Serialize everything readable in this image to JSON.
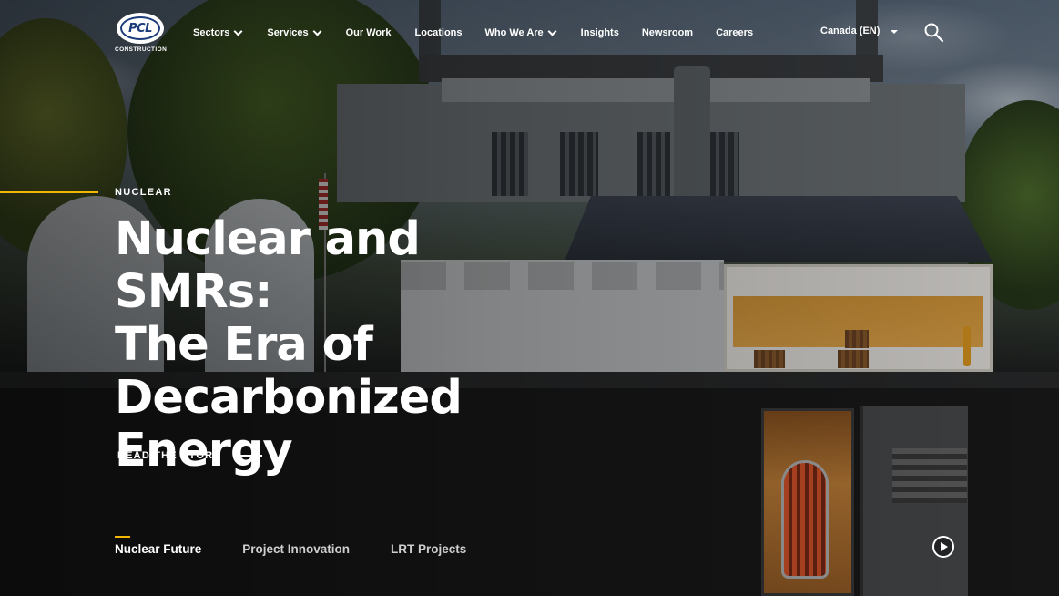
{
  "header": {
    "logo": {
      "name": "PCL",
      "subtitle": "CONSTRUCTION"
    },
    "nav": [
      {
        "label": "Sectors",
        "has_dropdown": true
      },
      {
        "label": "Services",
        "has_dropdown": true
      },
      {
        "label": "Our Work",
        "has_dropdown": false
      },
      {
        "label": "Locations",
        "has_dropdown": false
      },
      {
        "label": "Who We Are",
        "has_dropdown": true
      },
      {
        "label": "Insights",
        "has_dropdown": false
      },
      {
        "label": "Newsroom",
        "has_dropdown": false
      },
      {
        "label": "Careers",
        "has_dropdown": false
      }
    ],
    "language": "Canada (EN)",
    "search_icon": "search-icon"
  },
  "hero": {
    "eyebrow": "NUCLEAR",
    "title_lines": [
      "Nuclear and SMRs:",
      "The Era of",
      "Decarbonized",
      "Energy"
    ],
    "cta": "READ THE STORY",
    "tabs": [
      {
        "label": "Nuclear Future",
        "active": true
      },
      {
        "label": "Project Innovation",
        "active": false
      },
      {
        "label": "LRT Projects",
        "active": false
      }
    ],
    "video_icon": "play-icon"
  },
  "colors": {
    "accent": "#f2b705",
    "logo_blue": "#1b3c7a",
    "text": "#ffffff"
  }
}
